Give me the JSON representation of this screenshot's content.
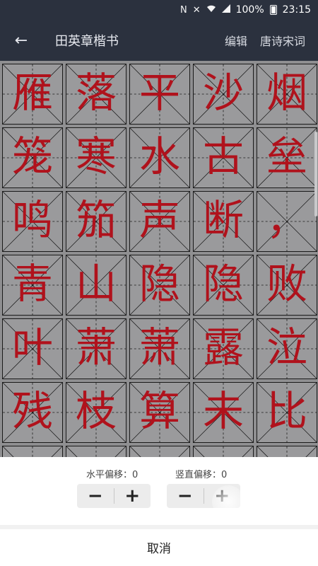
{
  "status_bar": {
    "battery": "100%",
    "time": "23:15",
    "icons": [
      "nfc-icon",
      "mute-icon",
      "wifi-icon",
      "signal-icon",
      "battery-icon"
    ]
  },
  "app_bar": {
    "back_icon": "back-arrow-icon",
    "title": "田英章楷书",
    "edit_label": "编辑",
    "poetry_label": "唐诗宋词"
  },
  "grid": {
    "chars": [
      "雁",
      "落",
      "平",
      "沙",
      "烟",
      "笼",
      "寒",
      "水",
      "古",
      "垒",
      "鸣",
      "笳",
      "声",
      "断",
      "，",
      "青",
      "山",
      "隐",
      "隐",
      "败",
      "叶",
      "萧",
      "萧",
      "露",
      "泣",
      "残",
      "枝",
      "算",
      "未",
      "比",
      "",
      "",
      "",
      "",
      ""
    ],
    "colors": {
      "char": "#b0121c",
      "cell_bg": "#9a9a9c",
      "grid_bg": "#8f8f91"
    }
  },
  "sheet": {
    "horizontal_offset_label": "水平偏移：0",
    "vertical_offset_label": "竖直偏移：0",
    "minus_symbol": "−",
    "plus_symbol": "+",
    "cancel_label": "取消"
  }
}
